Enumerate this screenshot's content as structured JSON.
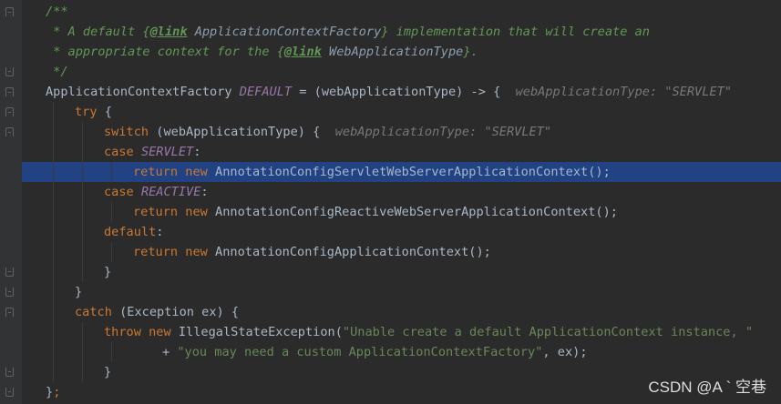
{
  "editor": {
    "lines": [
      {
        "indent": 0,
        "segments": [
          {
            "cls": "c",
            "text": "/**"
          }
        ]
      },
      {
        "indent": 0,
        "segments": [
          {
            "cls": "c",
            "text": " * A default {"
          },
          {
            "cls": "tag",
            "text": "@link"
          },
          {
            "cls": "c",
            "text": " "
          },
          {
            "cls": "ref",
            "text": "ApplicationContextFactory"
          },
          {
            "cls": "c",
            "text": "} implementation that will create an"
          }
        ]
      },
      {
        "indent": 0,
        "segments": [
          {
            "cls": "c",
            "text": " * appropriate context for the {"
          },
          {
            "cls": "tag",
            "text": "@link"
          },
          {
            "cls": "c",
            "text": " "
          },
          {
            "cls": "ref",
            "text": "WebApplicationType"
          },
          {
            "cls": "c",
            "text": "}."
          }
        ]
      },
      {
        "indent": 0,
        "segments": [
          {
            "cls": "c",
            "text": " */"
          }
        ]
      },
      {
        "indent": 0,
        "segments": [
          {
            "cls": "",
            "text": "ApplicationContextFactory "
          },
          {
            "cls": "cst",
            "text": "DEFAULT"
          },
          {
            "cls": "",
            "text": " = (webApplicationType) -> {  "
          },
          {
            "cls": "hint",
            "text": "webApplicationType: \"SERVLET\""
          }
        ]
      },
      {
        "indent": 1,
        "segments": [
          {
            "cls": "k",
            "text": "try"
          },
          {
            "cls": "",
            "text": " {"
          }
        ]
      },
      {
        "indent": 2,
        "segments": [
          {
            "cls": "k",
            "text": "switch"
          },
          {
            "cls": "",
            "text": " (webApplicationType) {  "
          },
          {
            "cls": "hint",
            "text": "webApplicationType: \"SERVLET\""
          }
        ]
      },
      {
        "indent": 2,
        "segments": [
          {
            "cls": "k",
            "text": "case"
          },
          {
            "cls": "",
            "text": " "
          },
          {
            "cls": "cst",
            "text": "SERVLET"
          },
          {
            "cls": "",
            "text": ":"
          }
        ]
      },
      {
        "indent": 3,
        "current": true,
        "segments": [
          {
            "cls": "k",
            "text": "return new"
          },
          {
            "cls": "",
            "text": " AnnotationConfigServletWebServerApplicationContext();"
          }
        ]
      },
      {
        "indent": 2,
        "segments": [
          {
            "cls": "k",
            "text": "case"
          },
          {
            "cls": "",
            "text": " "
          },
          {
            "cls": "cst",
            "text": "REACTIVE"
          },
          {
            "cls": "",
            "text": ":"
          }
        ]
      },
      {
        "indent": 3,
        "segments": [
          {
            "cls": "k",
            "text": "return new"
          },
          {
            "cls": "",
            "text": " AnnotationConfigReactiveWebServerApplicationContext();"
          }
        ]
      },
      {
        "indent": 2,
        "segments": [
          {
            "cls": "k",
            "text": "default"
          },
          {
            "cls": "",
            "text": ":"
          }
        ]
      },
      {
        "indent": 3,
        "segments": [
          {
            "cls": "k",
            "text": "return new"
          },
          {
            "cls": "",
            "text": " AnnotationConfigApplicationContext();"
          }
        ]
      },
      {
        "indent": 2,
        "segments": [
          {
            "cls": "",
            "text": "}"
          }
        ]
      },
      {
        "indent": 1,
        "segments": [
          {
            "cls": "",
            "text": "}"
          }
        ]
      },
      {
        "indent": 1,
        "segments": [
          {
            "cls": "k",
            "text": "catch"
          },
          {
            "cls": "",
            "text": " (Exception ex) {"
          }
        ]
      },
      {
        "indent": 2,
        "segments": [
          {
            "cls": "k",
            "text": "throw new"
          },
          {
            "cls": "",
            "text": " IllegalStateException("
          },
          {
            "cls": "s",
            "text": "\"Unable create a default ApplicationContext instance, \""
          }
        ]
      },
      {
        "indent": 4,
        "segments": [
          {
            "cls": "",
            "text": "+ "
          },
          {
            "cls": "s",
            "text": "\"you may need a custom ApplicationContextFactory\""
          },
          {
            "cls": "",
            "text": ", ex);"
          }
        ]
      },
      {
        "indent": 2,
        "segments": [
          {
            "cls": "",
            "text": "}"
          }
        ]
      },
      {
        "indent": 0,
        "segments": [
          {
            "cls": "",
            "text": "}"
          },
          {
            "cls": "k",
            "text": ";"
          }
        ]
      }
    ],
    "fold_markers": [
      {
        "line": 0,
        "kind": "open"
      },
      {
        "line": 3,
        "kind": "close"
      },
      {
        "line": 4,
        "kind": "open"
      },
      {
        "line": 5,
        "kind": "open"
      },
      {
        "line": 6,
        "kind": "open"
      },
      {
        "line": 13,
        "kind": "close"
      },
      {
        "line": 14,
        "kind": "close"
      },
      {
        "line": 15,
        "kind": "open"
      },
      {
        "line": 18,
        "kind": "close"
      },
      {
        "line": 19,
        "kind": "close"
      }
    ]
  },
  "watermark": {
    "text": "CSDN @A ` 空巷"
  },
  "colors": {
    "background": "#2b2b2b",
    "gutter": "#313335",
    "current_line": "#214283",
    "keyword": "#cc7832",
    "comment": "#629755",
    "string": "#6a8759",
    "constant": "#9876aa",
    "hint": "#787878",
    "default_text": "#a9b7c6"
  }
}
